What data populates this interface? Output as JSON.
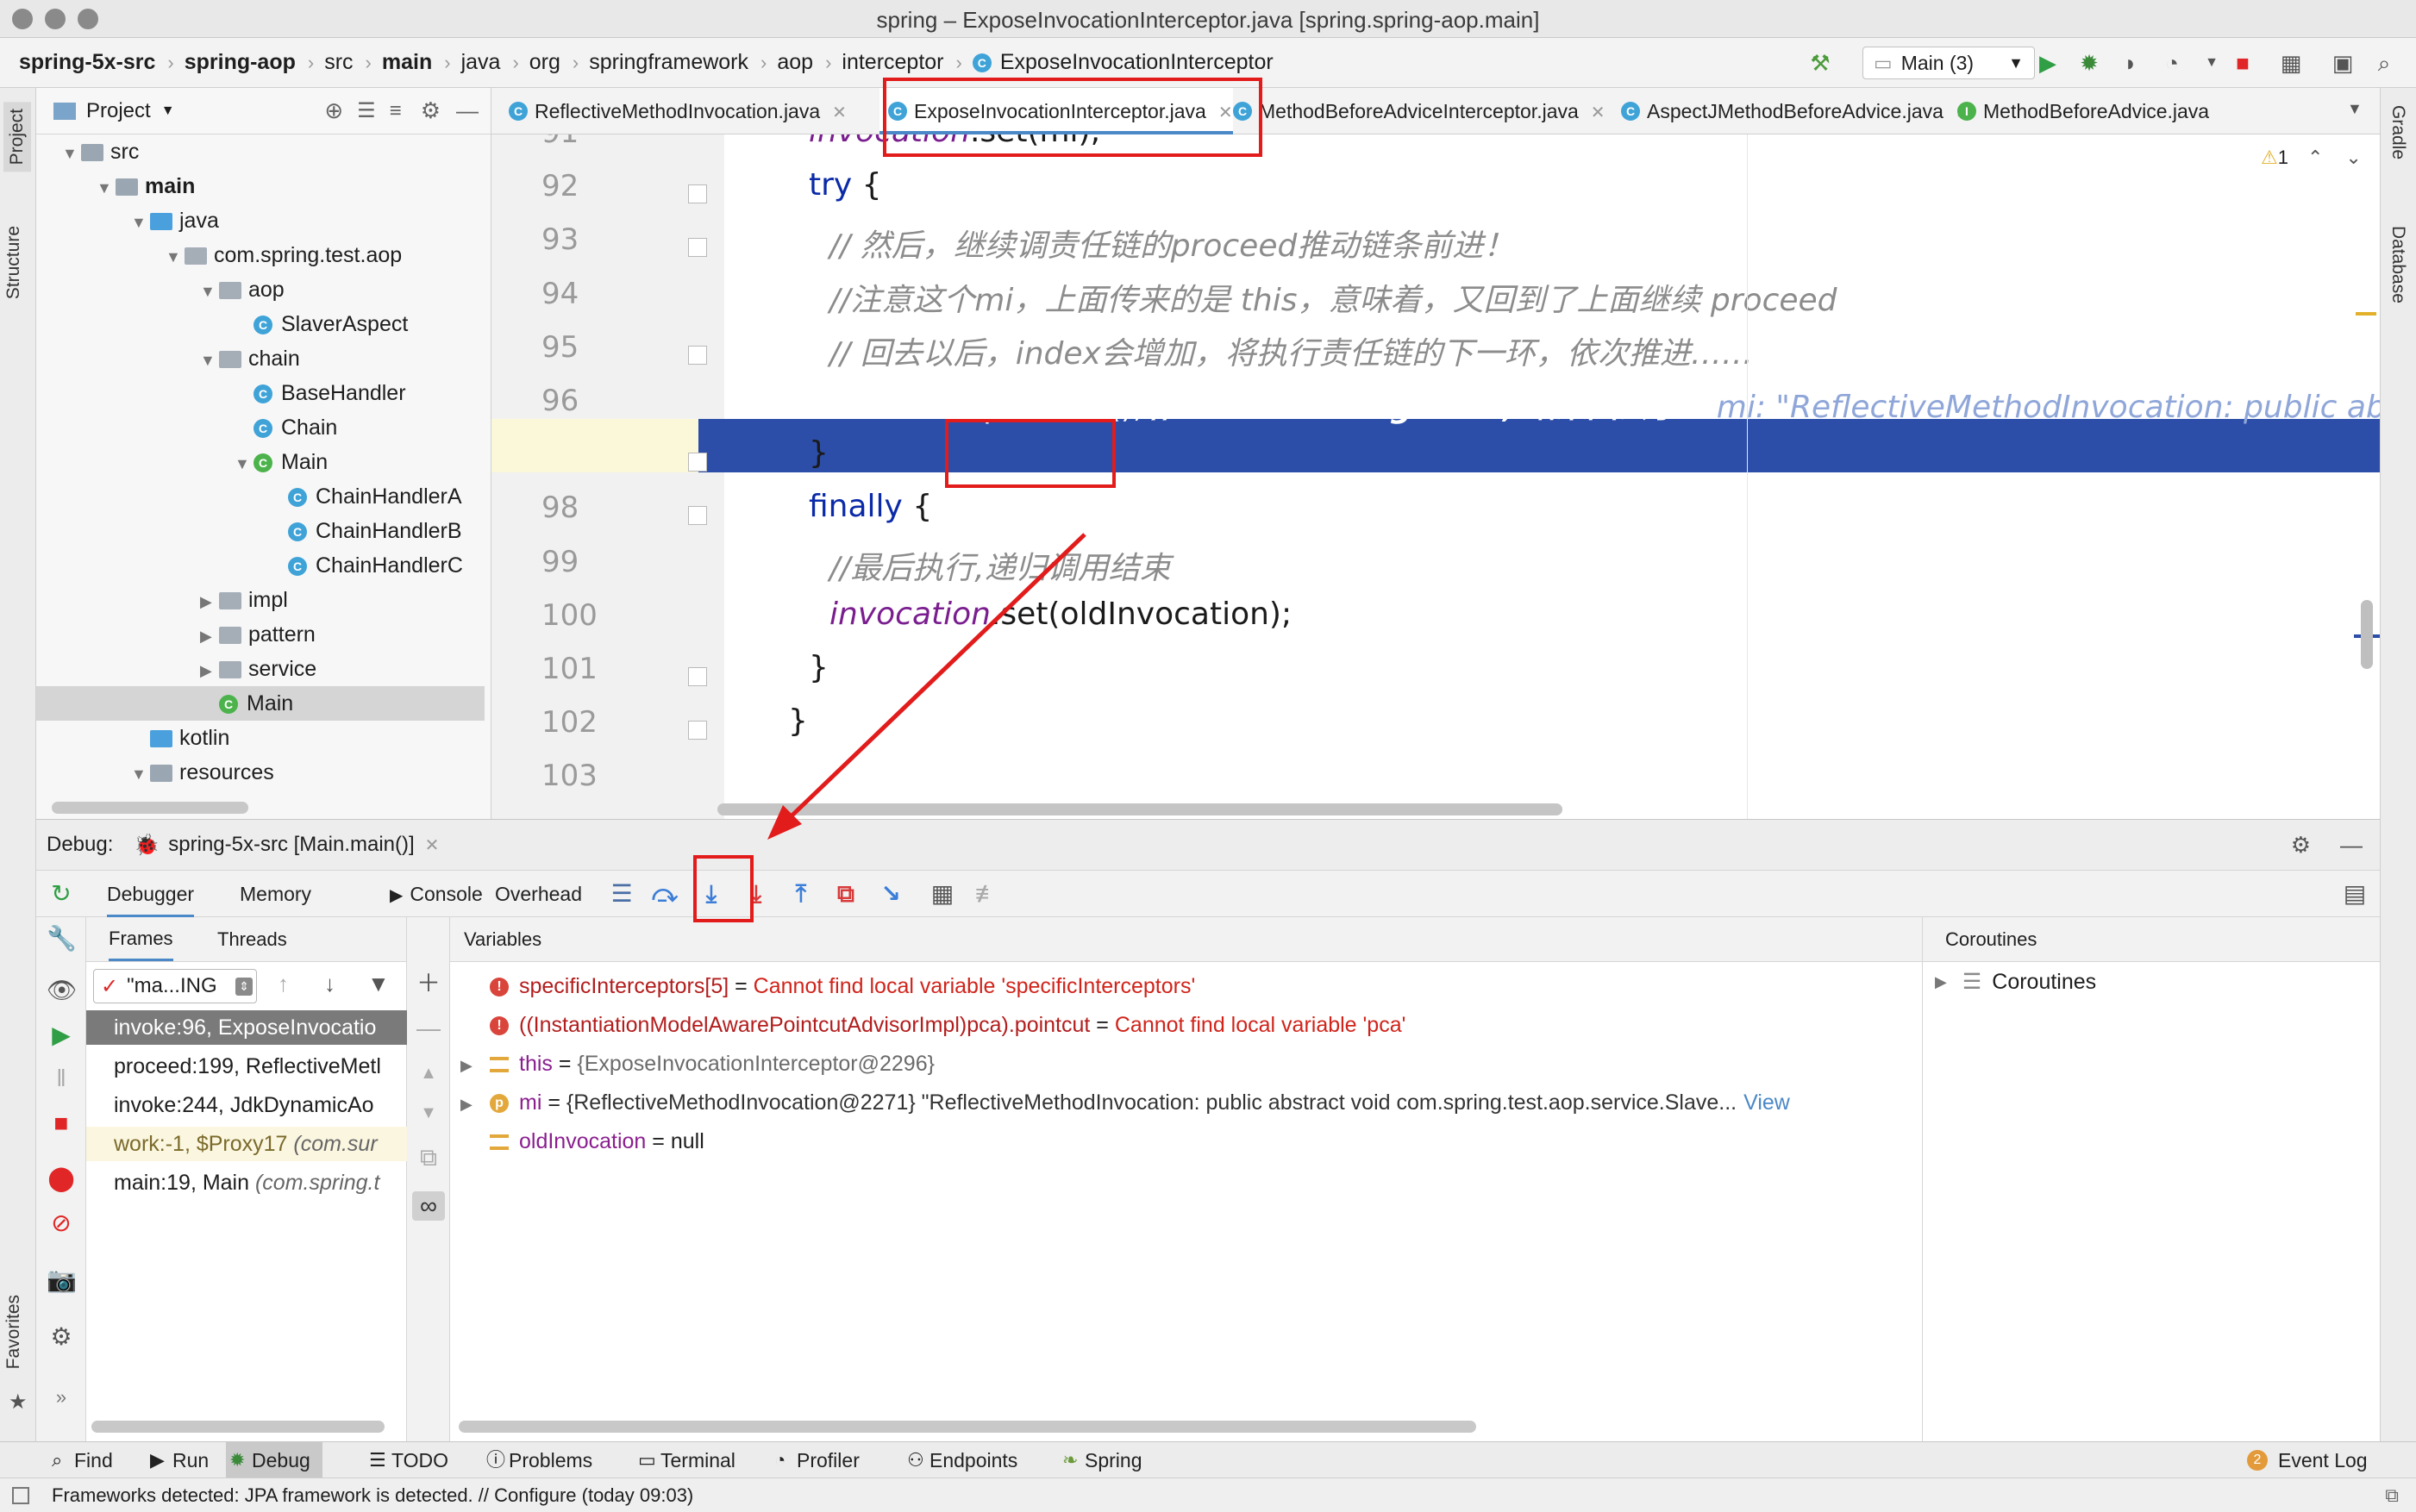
{
  "window": {
    "title": "spring – ExposeInvocationInterceptor.java [spring.spring-aop.main]"
  },
  "breadcrumb": [
    "spring-5x-src",
    "spring-aop",
    "src",
    "main",
    "java",
    "org",
    "springframework",
    "aop",
    "interceptor",
    "ExposeInvocationInterceptor"
  ],
  "run_config": "Main (3)",
  "side_tabs": {
    "project": "Project",
    "structure": "Structure",
    "favorites": "Favorites",
    "gradle": "Gradle",
    "database": "Database"
  },
  "project_panel": {
    "title": "Project",
    "tree": [
      {
        "label": "src",
        "level": 0,
        "kind": "folder",
        "arrow": "▼"
      },
      {
        "label": "main",
        "level": 1,
        "kind": "folder",
        "arrow": "▼",
        "bold": true
      },
      {
        "label": "java",
        "level": 2,
        "kind": "folder-blue",
        "arrow": "▼"
      },
      {
        "label": "com.spring.test.aop",
        "level": 3,
        "kind": "pkg",
        "arrow": "▼"
      },
      {
        "label": "aop",
        "level": 4,
        "kind": "pkg",
        "arrow": "▼"
      },
      {
        "label": "SlaverAspect",
        "level": 5,
        "kind": "class",
        "arrow": ""
      },
      {
        "label": "chain",
        "level": 4,
        "kind": "pkg",
        "arrow": "▼"
      },
      {
        "label": "BaseHandler",
        "level": 5,
        "kind": "class",
        "arrow": ""
      },
      {
        "label": "Chain",
        "level": 5,
        "kind": "class",
        "arrow": ""
      },
      {
        "label": "Main",
        "level": 5,
        "kind": "class-green",
        "arrow": "▼"
      },
      {
        "label": "ChainHandlerA",
        "level": 6,
        "kind": "class",
        "arrow": ""
      },
      {
        "label": "ChainHandlerB",
        "level": 6,
        "kind": "class",
        "arrow": ""
      },
      {
        "label": "ChainHandlerC",
        "level": 6,
        "kind": "class",
        "arrow": ""
      },
      {
        "label": "impl",
        "level": 4,
        "kind": "pkg",
        "arrow": "▶"
      },
      {
        "label": "pattern",
        "level": 4,
        "kind": "pkg",
        "arrow": "▶"
      },
      {
        "label": "service",
        "level": 4,
        "kind": "pkg",
        "arrow": "▶"
      },
      {
        "label": "Main",
        "level": 4,
        "kind": "class-green",
        "arrow": "",
        "selected": true
      },
      {
        "label": "kotlin",
        "level": 2,
        "kind": "folder-blue",
        "arrow": ""
      },
      {
        "label": "resources",
        "level": 2,
        "kind": "folder",
        "arrow": "▼"
      }
    ]
  },
  "editor_tabs": [
    {
      "label": "ReflectiveMethodInvocation.java",
      "icon": "C"
    },
    {
      "label": "ExposeInvocationInterceptor.java",
      "icon": "C",
      "active": true
    },
    {
      "label": "MethodBeforeAdviceInterceptor.java",
      "icon": "C"
    },
    {
      "label": "AspectJMethodBeforeAdvice.java",
      "icon": "C"
    },
    {
      "label": "MethodBeforeAdvice.java",
      "icon": "I"
    }
  ],
  "editor": {
    "warning_count": "1",
    "lines": [
      {
        "no": "91",
        "segments": [
          {
            "t": "invocation",
            "c": "purple ital"
          },
          {
            "t": ".set(mi);",
            "c": ""
          }
        ],
        "indent": 0
      },
      {
        "no": "92",
        "segments": [
          {
            "t": "try",
            "c": "kw"
          },
          {
            "t": " {",
            "c": ""
          }
        ],
        "indent": 0
      },
      {
        "no": "93",
        "segments": [
          {
            "t": "// 然后，继续调责任链的proceed推动链条前进！",
            "c": "comment"
          }
        ],
        "indent": 1
      },
      {
        "no": "94",
        "segments": [
          {
            "t": "//注意这个mi，上面传来的是 this，意味着，又回到了上面继续 proceed",
            "c": "comment"
          }
        ],
        "indent": 1
      },
      {
        "no": "95",
        "segments": [
          {
            "t": "// 回去以后，index会增加，将执行责任链的下一环，依次推进……",
            "c": "comment"
          }
        ],
        "indent": 1
      },
      {
        "no": "96",
        "segments": [
          {
            "t": "return mi.proceed();",
            "c": ""
          },
          {
            "t": "  // ===> debug into , 结果回去了~",
            "c": "ital bold"
          },
          {
            "t": "   mi: \"ReflectiveMethodInvocation: public abstract vo",
            "c": "ital dim"
          }
        ],
        "indent": 1,
        "exec": true
      },
      {
        "no": "97",
        "segments": [
          {
            "t": "}",
            "c": ""
          }
        ],
        "indent": 0
      },
      {
        "no": "98",
        "segments": [
          {
            "t": "finally",
            "c": "kw"
          },
          {
            "t": " {",
            "c": ""
          }
        ],
        "indent": 0
      },
      {
        "no": "99",
        "segments": [
          {
            "t": "//最后执行,递归调用结束",
            "c": "comment"
          }
        ],
        "indent": 1
      },
      {
        "no": "100",
        "segments": [
          {
            "t": "invocation",
            "c": "purple ital"
          },
          {
            "t": ".set(oldInvocation);",
            "c": ""
          }
        ],
        "indent": 1
      },
      {
        "no": "101",
        "segments": [
          {
            "t": "}",
            "c": ""
          }
        ],
        "indent": 0
      },
      {
        "no": "102",
        "segments": [
          {
            "t": "}",
            "c": ""
          }
        ],
        "indent": -1
      },
      {
        "no": "103",
        "segments": [],
        "indent": 0
      }
    ]
  },
  "debug": {
    "label": "Debug:",
    "session": "spring-5x-src [Main.main()]",
    "tabs": [
      "Debugger",
      "Memory",
      "Console",
      "Overhead"
    ],
    "frames_tab": "Frames",
    "threads_tab": "Threads",
    "thread_select": "\"ma...ING",
    "frames": [
      {
        "text": "invoke:96, ExposeInvocatio",
        "pkg": "",
        "selected": true
      },
      {
        "text": "proceed:199, ReflectiveMetl",
        "pkg": ""
      },
      {
        "text": "invoke:244, JdkDynamicAo",
        "pkg": ""
      },
      {
        "text": "work:-1, $Proxy17 ",
        "pkg": "(com.sur",
        "lib": true
      },
      {
        "text": "main:19, Main ",
        "pkg": "(com.spring.t"
      }
    ],
    "variables_title": "Variables",
    "variables": [
      {
        "kind": "error",
        "name": "specificInterceptors[5]",
        "eq": " = ",
        "value": "Cannot find local variable 'specificInterceptors'"
      },
      {
        "kind": "error",
        "name": "((InstantiationModelAwarePointcutAdvisorImpl)pca).pointcut",
        "eq": " = ",
        "value": "Cannot find local variable 'pca'"
      },
      {
        "kind": "field",
        "name": "this",
        "eq": " = ",
        "value": "{ExposeInvocationInterceptor@2296}",
        "expandable": true
      },
      {
        "kind": "param",
        "name": "mi",
        "eq": " = ",
        "value": "{ReflectiveMethodInvocation@2271} \"ReflectiveMethodInvocation: public abstract void com.spring.test.aop.service.Slave...",
        "link": "View",
        "expandable": true
      },
      {
        "kind": "field",
        "name": "oldInvocation",
        "eq": " = ",
        "value": "null"
      }
    ],
    "coroutines_title": "Coroutines",
    "coroutines_item": "Coroutines"
  },
  "bottom_tools": [
    "Find",
    "Run",
    "Debug",
    "TODO",
    "Problems",
    "Terminal",
    "Profiler",
    "Endpoints",
    "Spring"
  ],
  "event_log": {
    "count": "2",
    "label": "Event Log"
  },
  "status": "Frameworks detected: JPA framework is detected. // Configure (today 09:03)",
  "colors": {
    "exec_line": "#2c4ea8",
    "accent": "#4a88c7",
    "annotation": "#e21b1b"
  }
}
